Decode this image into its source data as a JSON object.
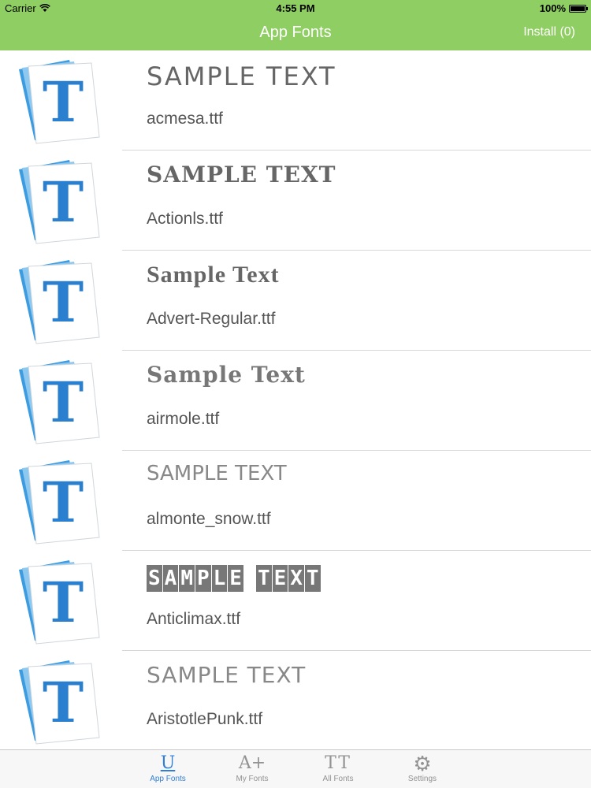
{
  "status_bar": {
    "carrier": "Carrier",
    "time": "4:55 PM",
    "battery": "100%"
  },
  "nav": {
    "title": "App Fonts",
    "install_button": "Install (0)"
  },
  "fonts": [
    {
      "sample": "SAMPLE TEXT",
      "filename": "acmesa.ttf"
    },
    {
      "sample": "SAMPLE TEXT",
      "filename": "Actionls.ttf"
    },
    {
      "sample": "Sample Text",
      "filename": "Advert-Regular.ttf"
    },
    {
      "sample": "Sample Text",
      "filename": "airmole.ttf"
    },
    {
      "sample": "SAMPLE TEXT",
      "filename": "almonte_snow.ttf"
    },
    {
      "sample": "SAMPLE TEXT",
      "filename": "Anticlimax.ttf"
    },
    {
      "sample": "SAMPLE TEXT",
      "filename": "AristotlePunk.ttf"
    }
  ],
  "tabs": [
    {
      "label": "App Fonts",
      "icon": "app-fonts-icon",
      "glyph": "U",
      "active": true
    },
    {
      "label": "My Fonts",
      "icon": "my-fonts-icon",
      "glyph": "A+",
      "active": false
    },
    {
      "label": "All Fonts",
      "icon": "all-fonts-icon",
      "glyph": "TT",
      "active": false
    },
    {
      "label": "Settings",
      "icon": "gear-icon",
      "glyph": "⚙",
      "active": false
    }
  ],
  "colors": {
    "nav_background": "#8fce62",
    "active_tab": "#2f7fd6",
    "inactive_tab": "#929292"
  }
}
